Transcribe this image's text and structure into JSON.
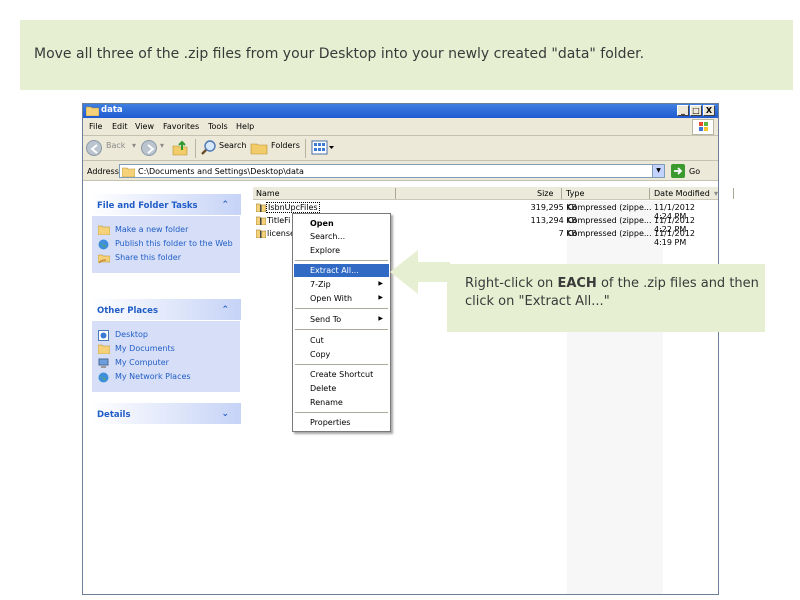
{
  "instruction": {
    "text": "Move all three of the .zip files from your Desktop into your newly created \"data\" folder."
  },
  "window": {
    "title": "data",
    "controls": [
      "_",
      "□",
      "X"
    ]
  },
  "menubar": [
    "File",
    "Edit",
    "View",
    "Favorites",
    "Tools",
    "Help"
  ],
  "toolbar": {
    "back_label": "Back",
    "search_label": "Search",
    "folders_label": "Folders"
  },
  "address": {
    "label": "Address",
    "value": "C:\\Documents and Settings\\Desktop\\data",
    "go_label": "Go"
  },
  "tasks": {
    "file_folder": {
      "title": "File and Folder Tasks",
      "items": [
        "Make a new folder",
        "Publish this folder to the Web",
        "Share this folder"
      ]
    },
    "other_places": {
      "title": "Other Places",
      "items": [
        "Desktop",
        "My Documents",
        "My Computer",
        "My Network Places"
      ]
    },
    "details": {
      "title": "Details"
    }
  },
  "columns": {
    "name": "Name",
    "size": "Size",
    "type": "Type",
    "date": "Date Modified"
  },
  "files": [
    {
      "name": "IsbnUpcFiles",
      "size": "319,295 KB",
      "type": "Compressed (zippe...",
      "date": "11/1/2012 4:24 PM"
    },
    {
      "name": "TitleFi",
      "size": "113,294 KB",
      "type": "Compressed (zippe...",
      "date": "11/1/2012 4:22 PM"
    },
    {
      "name": "license",
      "size": "7 KB",
      "type": "Compressed (zippe...",
      "date": "11/1/2012 4:19 PM"
    }
  ],
  "context_menu": {
    "open": "Open",
    "search": "Search...",
    "explore": "Explore",
    "extract_all": "Extract All...",
    "seven_zip": "7-Zip",
    "open_with": "Open With",
    "send_to": "Send To",
    "cut": "Cut",
    "copy": "Copy",
    "create_shortcut": "Create Shortcut",
    "delete": "Delete",
    "rename": "Rename",
    "properties": "Properties"
  },
  "callout": {
    "prefix": "Right-click on ",
    "emphasis": "EACH",
    "suffix": " of the .zip files and then click on \"Extract All...\""
  },
  "colors": {
    "banner_bg": "#e6efd2",
    "titlebar": "#2a63d6",
    "task_link": "#215dc6",
    "highlight": "#316ac5"
  }
}
